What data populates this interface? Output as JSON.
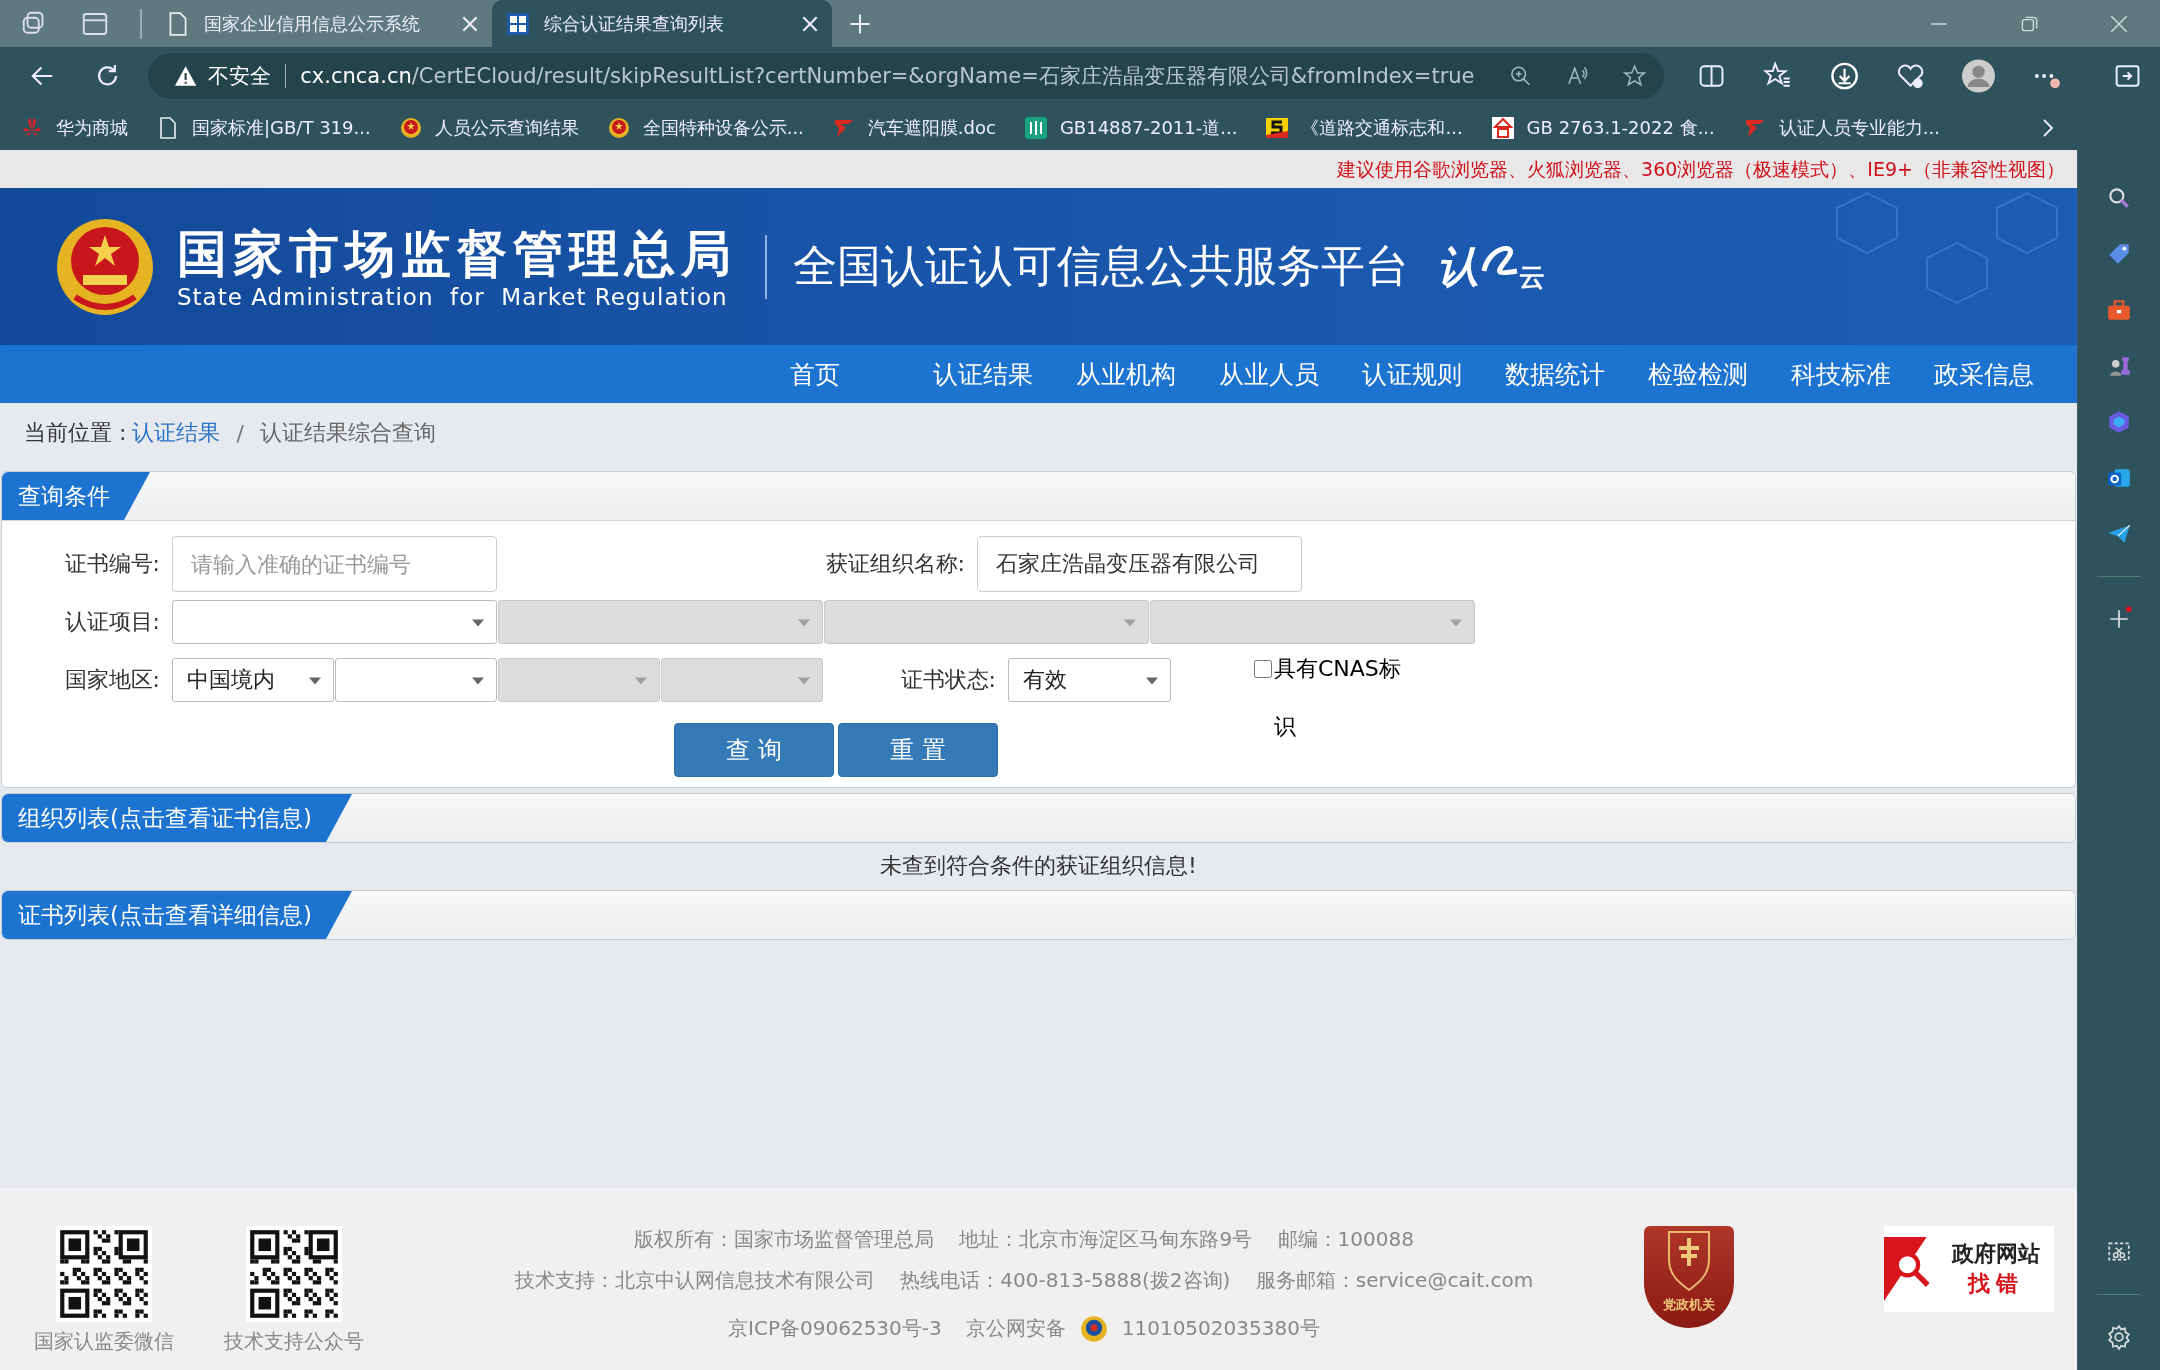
{
  "browser": {
    "tabs": [
      {
        "title": "国家企业信用信息公示系统",
        "selected": false
      },
      {
        "title": "综合认证结果查询列表",
        "selected": true
      }
    ],
    "address": {
      "security": "不安全",
      "host": "cx.cnca.cn",
      "path": "/CertECloud/result/skipResultList?certNumber=&orgName=石家庄浩晶变压器有限公司&fromIndex=true"
    },
    "bookmarks": [
      {
        "label": "华为商城",
        "kind": "huawei"
      },
      {
        "label": "国家标准|GB/T 319...",
        "kind": "page"
      },
      {
        "label": "人员公示查询结果",
        "kind": "emblem"
      },
      {
        "label": "全国特种设备公示...",
        "kind": "emblem"
      },
      {
        "label": "汽车遮阳膜.doc",
        "kind": "redmark"
      },
      {
        "label": "GB14887-2011-道...",
        "kind": "green"
      },
      {
        "label": "《道路交通标志和...",
        "kind": "yellow"
      },
      {
        "label": "GB  2763.1-2022 食...",
        "kind": "food"
      },
      {
        "label": "认证人员专业能力...",
        "kind": "redmark"
      }
    ]
  },
  "notice": "建议使用谷歌浏览器、火狐浏览器、360浏览器（极速模式）、IE9+（非兼容性视图）",
  "header": {
    "title": "国家市场监督管理总局",
    "subtitle": "State Administration  for  Market Regulation",
    "platform": "全国认证认可信息公共服务平台",
    "logo_chars": [
      "认",
      "云"
    ]
  },
  "nav": [
    "首页",
    "认证结果",
    "从业机构",
    "从业人员",
    "认证规则",
    "数据统计",
    "检验检测",
    "科技标准",
    "政采信息"
  ],
  "breadcrumb": {
    "label": "当前位置 :",
    "link": "认证结果",
    "separator": "/",
    "current": "认证结果综合查询"
  },
  "query": {
    "title": "查询条件",
    "cert_number": {
      "label": "证书编号:",
      "placeholder": "请输入准确的证书编号"
    },
    "org_name": {
      "label": "获证组织名称:",
      "value": "石家庄浩晶变压器有限公司"
    },
    "project": {
      "label": "认证项目:",
      "selects": [
        {
          "disabled": false
        },
        {
          "disabled": true
        },
        {
          "disabled": true
        },
        {
          "disabled": true
        }
      ]
    },
    "region": {
      "label": "国家地区:",
      "selects": [
        {
          "value": "中国境内",
          "disabled": false
        },
        {
          "disabled": false
        },
        {
          "disabled": true
        },
        {
          "disabled": true
        }
      ]
    },
    "status": {
      "label": "证书状态:",
      "value": "有效"
    },
    "cnas": {
      "label": "具有CNAS标识",
      "checked": false
    },
    "buttons": [
      "查 询",
      "重 置"
    ]
  },
  "org_list": {
    "title": "组织列表(点击查看证书信息)",
    "empty": "未查到符合条件的获证组织信息!"
  },
  "cert_list": {
    "title": "证书列表(点击查看详细信息)"
  },
  "footer": {
    "qr_codes": [
      "国家认监委微信",
      "技术支持公众号"
    ],
    "lines": [
      "版权所有：国家市场监督管理总局    地址：北京市海淀区马甸东路9号    邮编：100088",
      "技术支持：北京中认网信息技术有限公司    热线电话：400-813-5888(拨2咨询)    服务邮箱：service@cait.com"
    ],
    "icp": "京ICP备09062530号-3",
    "police": "京公网安备",
    "police_number": "11010502035380号",
    "party_badge": "党政机关",
    "gov_badge": [
      "政府网站",
      "找错"
    ]
  }
}
